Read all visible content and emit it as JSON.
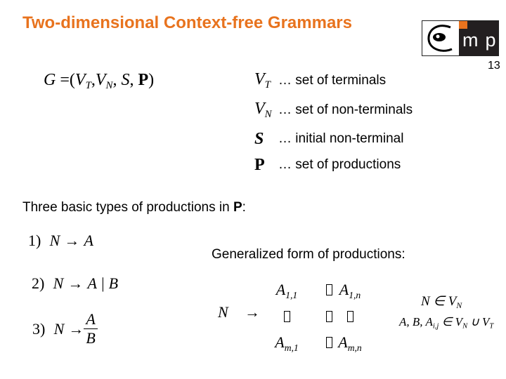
{
  "slide": {
    "title": "Two-dimensional Context-free Grammars",
    "page_number": "13",
    "logo": {
      "letters": "mp",
      "accent_color": "#e8731e",
      "dark_color": "#231f20"
    }
  },
  "grammar": {
    "lhs": "G",
    "equals": "=",
    "tuple_open": "(",
    "vt": "V",
    "vt_sub": "T",
    "vn": "V",
    "vn_sub": "N",
    "s": "S",
    "p": "P",
    "tuple_close": ")",
    "sep": ","
  },
  "definitions": [
    {
      "symbol": "V",
      "sub": "T",
      "text": "… set of terminals"
    },
    {
      "symbol": "V",
      "sub": "N",
      "text": "… set of non-terminals"
    },
    {
      "symbol": "S",
      "sub": "",
      "text": "… initial non-terminal"
    },
    {
      "symbol": "P",
      "sub": "",
      "text": "… set of productions"
    }
  ],
  "productions_intro": {
    "text": "Three basic types of productions in ",
    "bold": "P",
    "suffix": ":"
  },
  "productions": [
    {
      "num": "1)",
      "lhs": "N",
      "arrow": "→",
      "rhs": "A"
    },
    {
      "num": "2)",
      "lhs": "N",
      "arrow": "→",
      "rhs": "A | B"
    },
    {
      "num": "3)",
      "lhs": "N",
      "arrow": "→",
      "numerator": "A",
      "denominator": "B"
    }
  ],
  "generalized": {
    "label": "Generalized form of productions:",
    "lhs": "N",
    "arrow": "→",
    "matrix": {
      "a11": "A",
      "a11_sub": "1,1",
      "a1n": "A",
      "a1n_sub": "1,n",
      "am1": "A",
      "am1_sub": "m,1",
      "amn": "A",
      "amn_sub": "m,n"
    },
    "conditions": [
      {
        "left": "N ∈ V",
        "left_sub": "N"
      },
      {
        "left": "A, B, A",
        "idx": "i,j",
        "mid": " ∈ V",
        "mid_sub": "N",
        "union": " ∪ V",
        "union_sub": "T"
      }
    ]
  }
}
